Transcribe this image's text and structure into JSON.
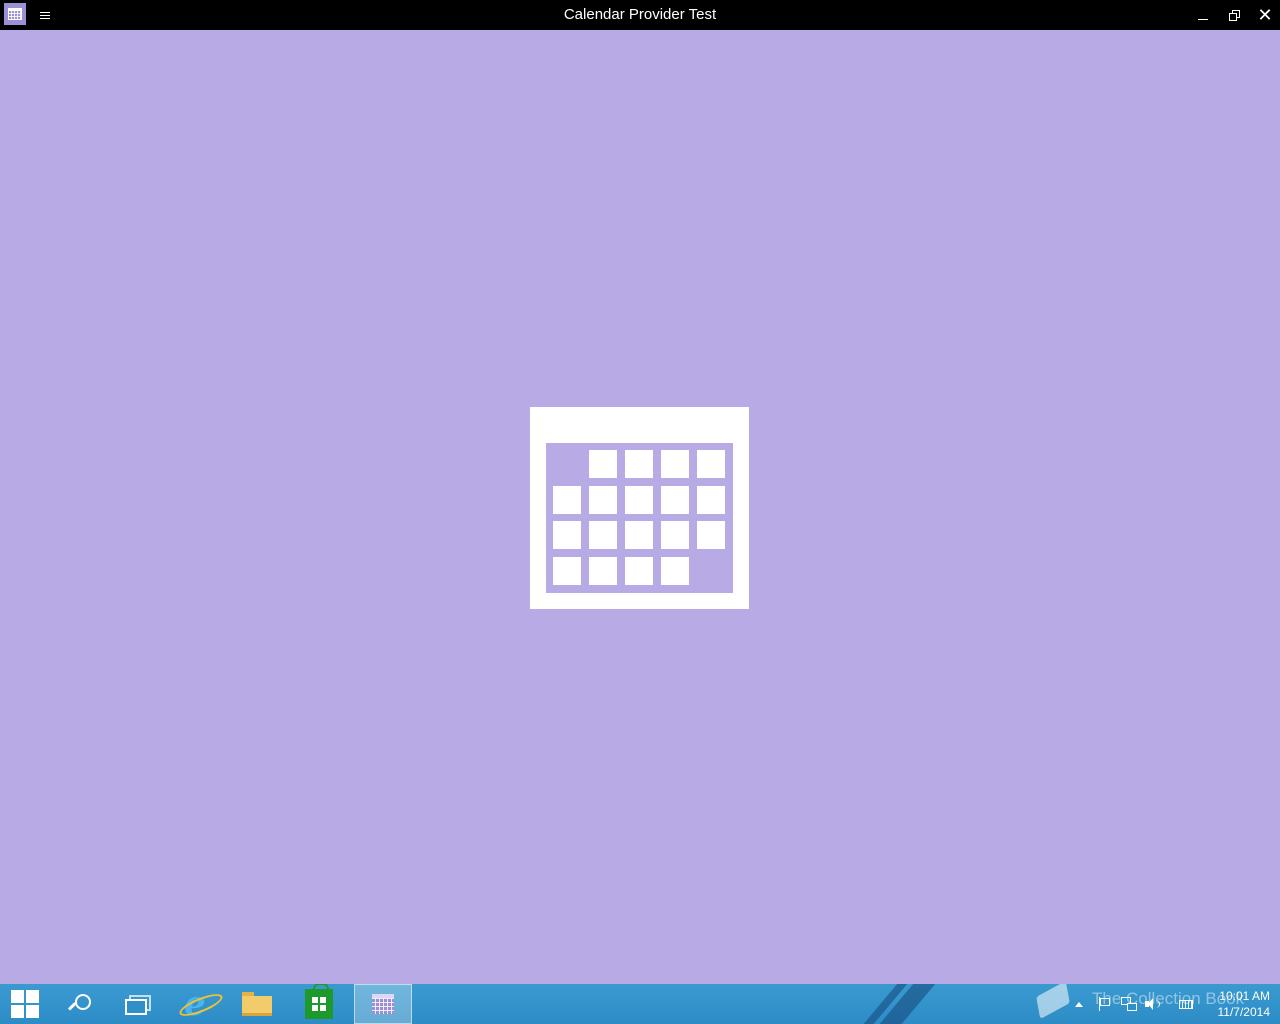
{
  "window": {
    "title": "Calendar Provider Test",
    "app_icon": "calendar-icon",
    "menu_icon": "hamburger-menu-icon",
    "controls": {
      "minimize": "minimize-icon",
      "restore": "restore-icon",
      "close": "close-icon",
      "close_glyph": "✕"
    }
  },
  "splash": {
    "icon": "calendar-icon",
    "background_color": "#b8aae4",
    "foreground_color": "#ffffff"
  },
  "taskbar": {
    "background_color": "#2f8fc9",
    "pinned": [
      {
        "name": "start-button",
        "icon": "windows-logo-icon"
      },
      {
        "name": "search-button",
        "icon": "search-icon"
      },
      {
        "name": "task-view-button",
        "icon": "task-view-icon"
      },
      {
        "name": "internet-explorer",
        "icon": "internet-explorer-icon",
        "glyph": "e"
      },
      {
        "name": "file-explorer",
        "icon": "folder-icon"
      },
      {
        "name": "store",
        "icon": "store-icon"
      },
      {
        "name": "calendar-provider-test",
        "icon": "calendar-icon",
        "active": true
      }
    ],
    "watermark": {
      "text": "The Collection Book",
      "icon": "book-icon"
    },
    "tray": {
      "icons": [
        "show-hidden-icons-icon",
        "action-center-flag-icon",
        "network-icon",
        "volume-icon",
        "touch-keyboard-icon"
      ],
      "time": "10:01 AM",
      "date": "11/7/2014"
    }
  }
}
